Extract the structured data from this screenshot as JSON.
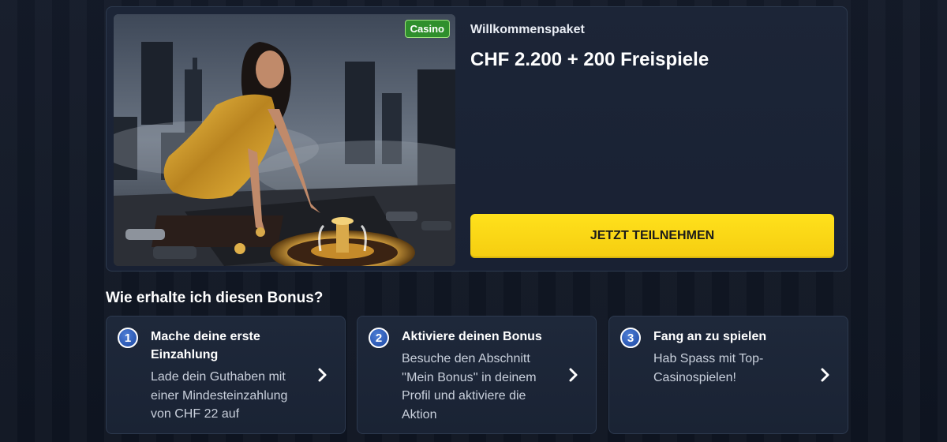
{
  "promo": {
    "badge": "Casino",
    "subtitle": "Willkommenspaket",
    "title": "CHF 2.200 + 200 Freispiele",
    "cta_label": "JETZT TEILNEHMEN"
  },
  "how_to": {
    "heading": "Wie erhalte ich diesen Bonus?",
    "steps": [
      {
        "number": "1",
        "title": "Mache deine erste Einzahlung",
        "description": "Lade dein Guthaben mit einer Mindesteinzahlung von CHF 22 auf",
        "icon": "chevron-right-icon"
      },
      {
        "number": "2",
        "title": "Aktiviere deinen Bonus",
        "description": "Besuche den Abschnitt ''Mein Bonus'' in deinem Profil und aktiviere die Aktion",
        "icon": "chevron-right-icon"
      },
      {
        "number": "3",
        "title": "Fang an zu spielen",
        "description": "Hab Spass mit Top-Casinospielen!",
        "icon": "chevron-right-icon"
      }
    ]
  },
  "colors": {
    "background": "#131a28",
    "card": "#1c2537",
    "cta": "#ffe11c",
    "badge": "#2f8f2c",
    "step_number": "#2a57b2"
  }
}
